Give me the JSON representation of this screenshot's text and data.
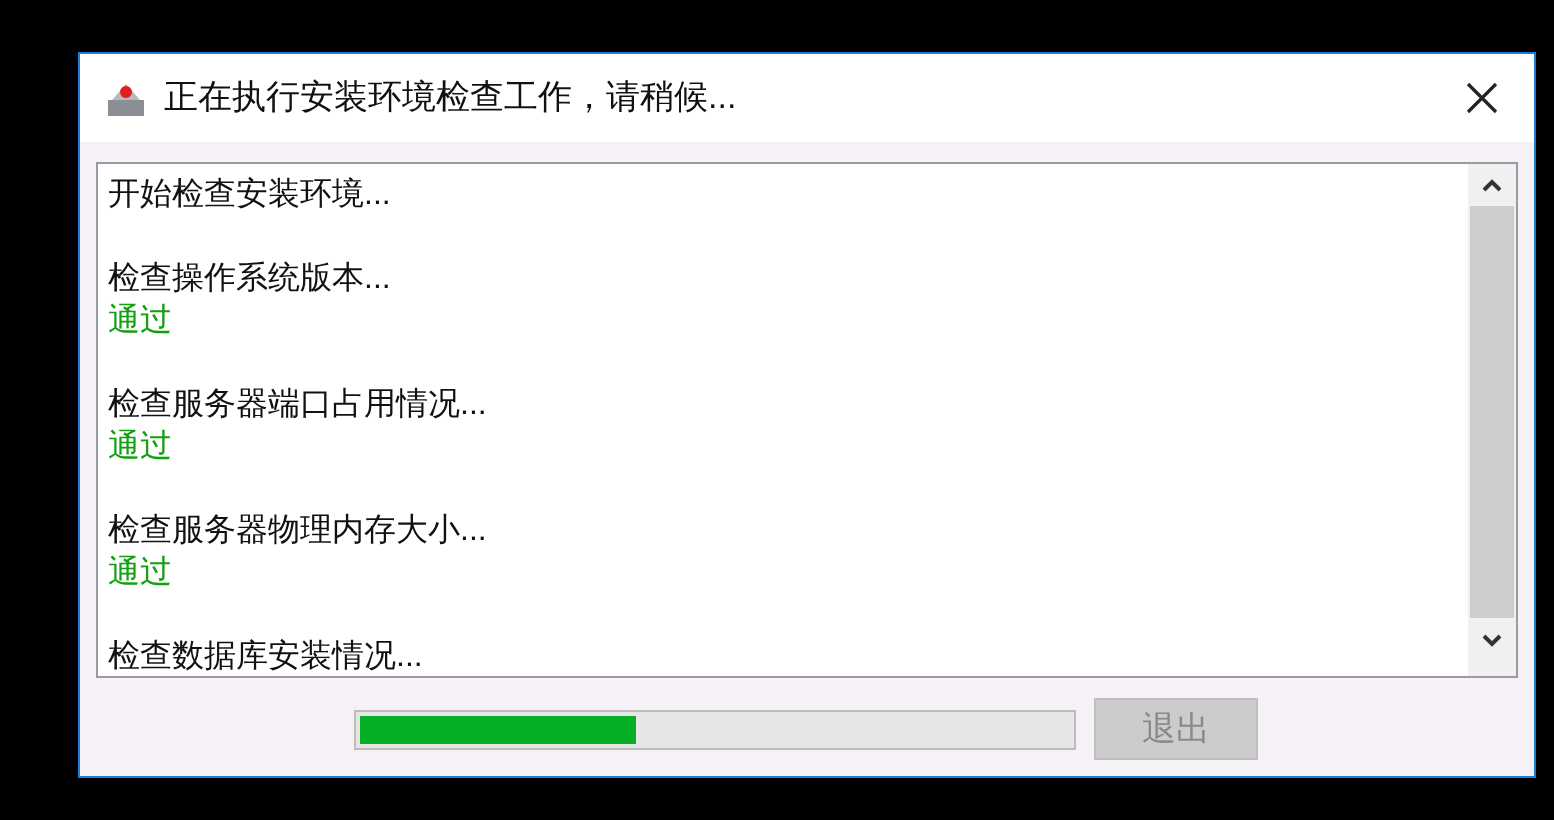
{
  "window": {
    "title": "正在执行安装环境检查工作，请稍候..."
  },
  "log": [
    {
      "text": "开始检查安装环境..."
    },
    {
      "text": "检查操作系统版本...",
      "result": {
        "text": "通过",
        "kind": "pass"
      }
    },
    {
      "text": "检查服务器端口占用情况...",
      "result": {
        "text": "通过",
        "kind": "pass"
      }
    },
    {
      "text": "检查服务器物理内存大小...",
      "result": {
        "text": "通过",
        "kind": "pass"
      }
    },
    {
      "text": "检查数据库安装情况..."
    }
  ],
  "progress": {
    "level": 0.39
  },
  "exit_button": {
    "label": "退出",
    "disabled": true
  }
}
